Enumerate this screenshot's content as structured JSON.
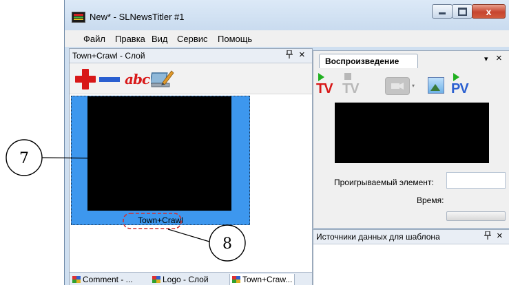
{
  "window": {
    "title": "New* - SLNewsTitler #1",
    "close_glyph": "x"
  },
  "menu": [
    "Файл",
    "Правка",
    "Вид",
    "Сервис",
    "Помощь"
  ],
  "left_panel": {
    "title": "Town+Crawl - Слой",
    "pin_glyph": "ꟷ",
    "close_glyph": "×",
    "toolbar": {
      "abc_label": "abc"
    },
    "layer": {
      "label": "Town+Crawl"
    },
    "tabs": [
      "Comment - ...",
      "Logo - Слой",
      "Town+Craw..."
    ]
  },
  "playback_panel": {
    "tab_label": "Воспроизведение",
    "dropdown_glyph": "▾",
    "close_glyph": "×",
    "toolbar": {
      "tv_label": "TV",
      "tv_disabled_label": "TV",
      "pv_label": "PV",
      "drop_glyph": "▾"
    },
    "playing_label": "Проигрываемый элемент:",
    "playing_value": "",
    "time_label": "Время:"
  },
  "sources_panel": {
    "title": "Источники данных для шаблона",
    "pin_glyph": "ꟷ",
    "close_glyph": "×"
  },
  "callouts": {
    "seven": "7",
    "eight": "8"
  },
  "colors": {
    "layer_bg": "#3d97ee",
    "accent_red": "#d81818",
    "accent_green": "#20b020",
    "accent_blue": "#2a5fd0"
  }
}
